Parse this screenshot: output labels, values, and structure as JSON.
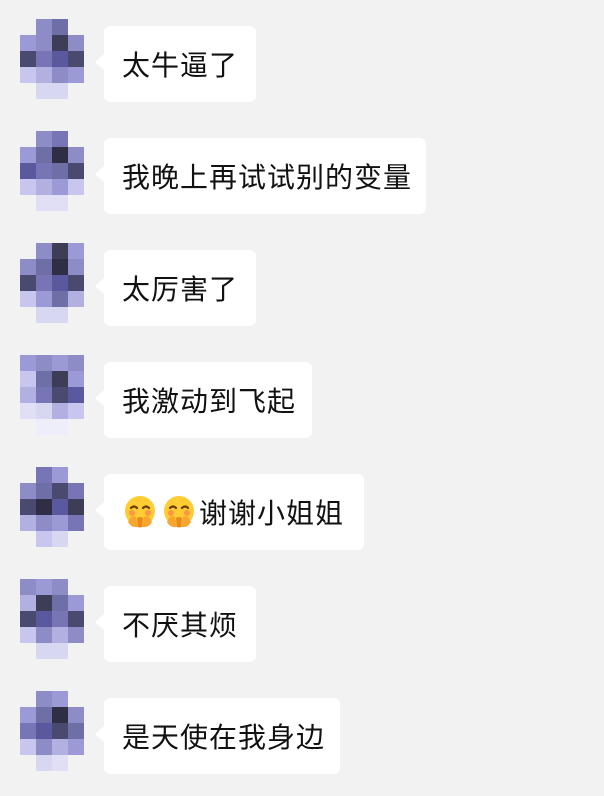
{
  "messages": [
    {
      "text": "太牛逼了",
      "emojis": []
    },
    {
      "text": "我晚上再试试别的变量",
      "emojis": []
    },
    {
      "text": "太厉害了",
      "emojis": []
    },
    {
      "text": "我激动到飞起",
      "emojis": []
    },
    {
      "text": "谢谢小姐姐",
      "emojis": [
        "shy-face-icon",
        "shy-face-icon"
      ]
    },
    {
      "text": "不厌其烦",
      "emojis": []
    },
    {
      "text": "是天使在我身边",
      "emojis": []
    }
  ],
  "theme": {
    "background": "#f2f2f2",
    "bubble": "#ffffff",
    "text": "#111111",
    "avatar_palette": [
      "#8e8cc6",
      "#6f6fa8",
      "#3e3d58",
      "#5a59a0",
      "#c8c6ee",
      "#d8d7f2",
      "#b2b0e0",
      "#9b99d6"
    ]
  }
}
